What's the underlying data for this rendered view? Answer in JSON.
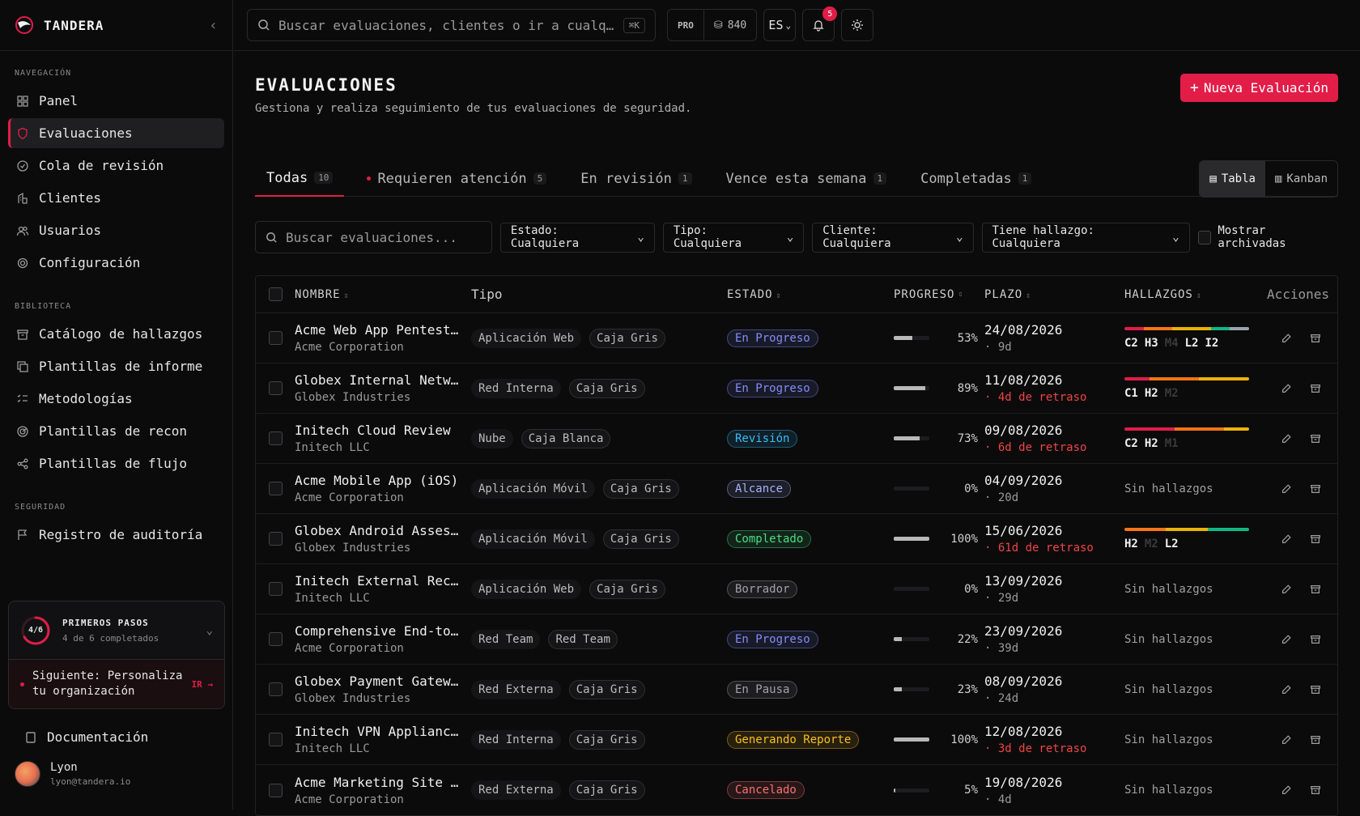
{
  "brand": {
    "name": "TANDERA"
  },
  "sidebar": {
    "sections": [
      {
        "title": "NAVEGACIÓN",
        "items": [
          {
            "label": "Panel",
            "icon": "grid-icon"
          },
          {
            "label": "Evaluaciones",
            "icon": "shield-icon",
            "active": true
          },
          {
            "label": "Cola de revisión",
            "icon": "check-circle-icon"
          },
          {
            "label": "Clientes",
            "icon": "building-icon"
          },
          {
            "label": "Usuarios",
            "icon": "users-icon"
          },
          {
            "label": "Configuración",
            "icon": "gear-icon"
          }
        ]
      },
      {
        "title": "BIBLIOTECA",
        "items": [
          {
            "label": "Catálogo de hallazgos",
            "icon": "archive-icon"
          },
          {
            "label": "Plantillas de informe",
            "icon": "copy-icon"
          },
          {
            "label": "Metodologías",
            "icon": "list-checks-icon"
          },
          {
            "label": "Plantillas de recon",
            "icon": "radar-icon"
          },
          {
            "label": "Plantillas de flujo",
            "icon": "share-icon"
          }
        ]
      },
      {
        "title": "SEGURIDAD",
        "items": [
          {
            "label": "Registro de auditoría",
            "icon": "flag-icon"
          }
        ]
      }
    ],
    "getting_started": {
      "progress": "4/6",
      "progress_fraction": 0.667,
      "title": "PRIMEROS PASOS",
      "subtitle": "4 de 6 completados",
      "next": "Siguiente: Personaliza tu organización",
      "go": "IR"
    },
    "docs": "Documentación",
    "user": {
      "name": "Lyon",
      "email": "lyon@tandera.io"
    }
  },
  "topbar": {
    "search_placeholder": "Buscar evaluaciones, clientes o ir a cualq…",
    "shortcut": "⌘K",
    "plan": "PRO",
    "credits": "840",
    "language": "ES",
    "notifications": "5"
  },
  "page": {
    "title": "EVALUACIONES",
    "subtitle": "Gestiona y realiza seguimiento de tus evaluaciones de seguridad.",
    "new_button": "Nueva Evaluación"
  },
  "tabs": [
    {
      "label": "Todas",
      "count": "10",
      "active": true
    },
    {
      "label": "Requieren atención",
      "count": "5",
      "dot": true
    },
    {
      "label": "En revisión",
      "count": "1"
    },
    {
      "label": "Vence esta semana",
      "count": "1"
    },
    {
      "label": "Completadas",
      "count": "1"
    }
  ],
  "views": {
    "table": "Tabla",
    "kanban": "Kanban"
  },
  "filters": {
    "search_placeholder": "Buscar evaluaciones...",
    "estado": "Estado: Cualquiera",
    "tipo": "Tipo: Cualquiera",
    "cliente": "Cliente: Cualquiera",
    "hallazgo": "Tiene hallazgo: Cualquiera",
    "archived": "Mostrar archivadas"
  },
  "columns": {
    "name": "NOMBRE",
    "type": "Tipo",
    "state": "ESTADO",
    "progress": "PROGRESO",
    "due": "PLAZO",
    "findings": "HALLAZGOS",
    "actions": "Acciones"
  },
  "colors": {
    "accent": "#e11d48",
    "critical": "#e11d48",
    "high": "#f97316",
    "medium": "#eab308",
    "low": "#10b981",
    "info": "#9ca3af"
  },
  "rows": [
    {
      "name": "Acme Web App Pentest…",
      "client": "Acme Corporation",
      "type": "Aplicación Web",
      "box": "Caja Gris",
      "state": "En Progreso",
      "state_color": "#818cf8",
      "progress": 53,
      "progress_label": "53%",
      "due": "24/08/2026",
      "rel": "· 9d",
      "late": false,
      "findings": [
        {
          "l": "C2",
          "c": "#e11d48",
          "n": 2
        },
        {
          "l": "H3",
          "c": "#f97316",
          "n": 3
        },
        {
          "l": "M4",
          "c": "#eab308",
          "n": 4,
          "dim": true
        },
        {
          "l": "L2",
          "c": "#10b981",
          "n": 2
        },
        {
          "l": "I2",
          "c": "#9ca3af",
          "n": 2
        }
      ]
    },
    {
      "name": "Globex Internal Netw…",
      "client": "Globex Industries",
      "type": "Red Interna",
      "box": "Caja Gris",
      "state": "En Progreso",
      "state_color": "#818cf8",
      "progress": 89,
      "progress_label": "89%",
      "due": "11/08/2026",
      "rel": "· 4d de retraso",
      "late": true,
      "findings": [
        {
          "l": "C1",
          "c": "#e11d48",
          "n": 1
        },
        {
          "l": "H2",
          "c": "#f97316",
          "n": 2
        },
        {
          "l": "M2",
          "c": "#eab308",
          "n": 2,
          "dim": true
        }
      ]
    },
    {
      "name": "Initech Cloud Review",
      "client": "Initech LLC",
      "type": "Nube",
      "box": "Caja Blanca",
      "state": "Revisión",
      "state_color": "#38bdf8",
      "progress": 73,
      "progress_label": "73%",
      "due": "09/08/2026",
      "rel": "· 6d de retraso",
      "late": true,
      "findings": [
        {
          "l": "C2",
          "c": "#e11d48",
          "n": 2
        },
        {
          "l": "H2",
          "c": "#f97316",
          "n": 2
        },
        {
          "l": "M1",
          "c": "#eab308",
          "n": 1,
          "dim": true
        }
      ]
    },
    {
      "name": "Acme Mobile App (iOS)",
      "client": "Acme Corporation",
      "type": "Aplicación Móvil",
      "box": "Caja Gris",
      "state": "Alcance",
      "state_color": "#a5b4fc",
      "progress": 0,
      "progress_label": "0%",
      "due": "04/09/2026",
      "rel": "· 20d",
      "late": false,
      "findings": [],
      "none": "Sin hallazgos"
    },
    {
      "name": "Globex Android Asses…",
      "client": "Globex Industries",
      "type": "Aplicación Móvil",
      "box": "Caja Gris",
      "state": "Completado",
      "state_color": "#4ade80",
      "progress": 100,
      "progress_label": "100%",
      "due": "15/06/2026",
      "rel": "· 61d de retraso",
      "late": true,
      "findings": [
        {
          "l": "H2",
          "c": "#f97316",
          "n": 2
        },
        {
          "l": "M2",
          "c": "#eab308",
          "n": 2,
          "dim": true
        },
        {
          "l": "L2",
          "c": "#10b981",
          "n": 2
        }
      ]
    },
    {
      "name": "Initech External Rec…",
      "client": "Initech LLC",
      "type": "Aplicación Web",
      "box": "Caja Gris",
      "state": "Borrador",
      "state_color": "#a1a1aa",
      "progress": 0,
      "progress_label": "0%",
      "due": "13/09/2026",
      "rel": "· 29d",
      "late": false,
      "findings": [],
      "none": "Sin hallazgos"
    },
    {
      "name": "Comprehensive End-to…",
      "client": "Acme Corporation",
      "type": "Red Team",
      "box": "Red Team",
      "state": "En Progreso",
      "state_color": "#818cf8",
      "progress": 22,
      "progress_label": "22%",
      "due": "23/09/2026",
      "rel": "· 39d",
      "late": false,
      "findings": [],
      "none": "Sin hallazgos"
    },
    {
      "name": "Globex Payment Gatew…",
      "client": "Globex Industries",
      "type": "Red Externa",
      "box": "Caja Gris",
      "state": "En Pausa",
      "state_color": "#a1a1aa",
      "progress": 23,
      "progress_label": "23%",
      "due": "08/09/2026",
      "rel": "· 24d",
      "late": false,
      "findings": [],
      "none": "Sin hallazgos"
    },
    {
      "name": "Initech VPN Applianc…",
      "client": "Initech LLC",
      "type": "Red Interna",
      "box": "Caja Gris",
      "state": "Generando Reporte",
      "state_color": "#fbbf24",
      "progress": 100,
      "progress_label": "100%",
      "due": "12/08/2026",
      "rel": "· 3d de retraso",
      "late": true,
      "findings": [],
      "none": "Sin hallazgos"
    },
    {
      "name": "Acme Marketing Site …",
      "client": "Acme Corporation",
      "type": "Red Externa",
      "box": "Caja Gris",
      "state": "Cancelado",
      "state_color": "#f87171",
      "progress": 5,
      "progress_label": "5%",
      "due": "19/08/2026",
      "rel": "· 4d",
      "late": false,
      "findings": [],
      "none": "Sin hallazgos"
    }
  ]
}
